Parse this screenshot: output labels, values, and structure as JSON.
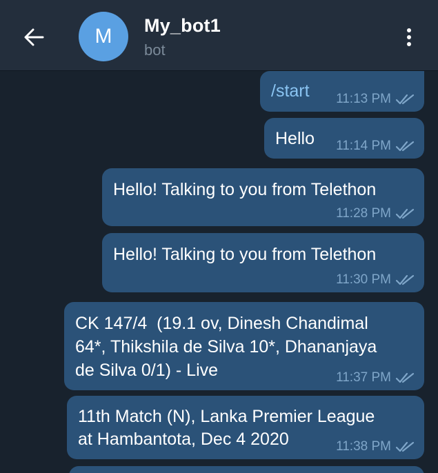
{
  "header": {
    "back_icon": "arrow-left-icon",
    "avatar_letter": "M",
    "avatar_color": "#5aa0e2",
    "title": "My_bot1",
    "subtitle": "bot",
    "menu_icon": "more-vertical-icon"
  },
  "colors": {
    "background": "#18222d",
    "header": "#232e3c",
    "outgoing_bubble": "#2b5278",
    "meta_text": "#7fa6c9"
  },
  "messages": [
    {
      "text": "/start",
      "time": "11:13 PM",
      "status": "read"
    },
    {
      "text": "Hello",
      "time": "11:14 PM",
      "status": "read"
    },
    {
      "text": "Hello! Talking to you from Telethon",
      "time": "11:28 PM",
      "status": "read"
    },
    {
      "text": "Hello! Talking to you from Telethon",
      "time": "11:30 PM",
      "status": "read"
    },
    {
      "text": "CK 147/4  (19.1 ov, Dinesh Chandimal\n64*, Thikshila de Silva 10*, Dhananjaya\nde Silva 0/1) - Live",
      "time": "11:37 PM",
      "status": "read"
    },
    {
      "text": "11th Match (N), Lanka Premier League\nat Hambantota, Dec 4 2020",
      "time": "11:38 PM",
      "status": "read"
    }
  ]
}
